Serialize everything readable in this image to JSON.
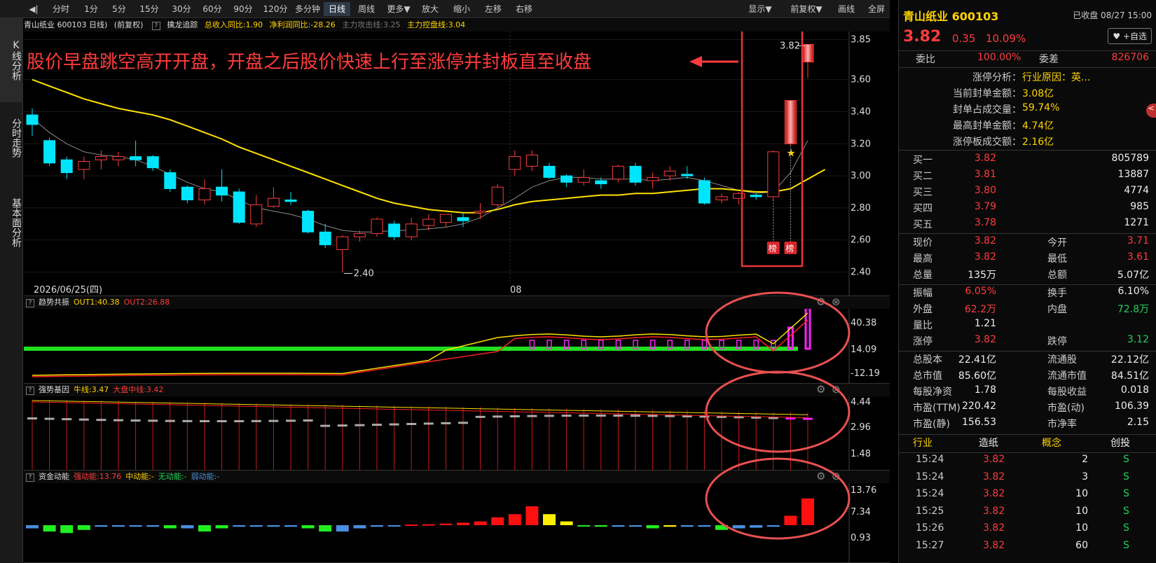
{
  "toolbar": {
    "items": [
      {
        "label": "◀|",
        "active": false
      },
      {
        "label": "分时",
        "active": false
      },
      {
        "label": "1分",
        "active": false
      },
      {
        "label": "5分",
        "active": false
      },
      {
        "label": "15分",
        "active": false
      },
      {
        "label": "30分",
        "active": false
      },
      {
        "label": "60分",
        "active": false
      },
      {
        "label": "90分",
        "active": false
      },
      {
        "label": "120分",
        "active": false
      },
      {
        "label": "多分钟",
        "active": false
      },
      {
        "label": "日线",
        "active": true
      },
      {
        "label": "周线",
        "active": false
      },
      {
        "label": "更多▼",
        "active": false
      },
      {
        "label": "放大",
        "active": false
      },
      {
        "label": "缩小",
        "active": false
      },
      {
        "label": "左移",
        "active": false
      },
      {
        "label": "右移",
        "active": false
      }
    ],
    "right_items": [
      "显示▼",
      "前复权▼",
      "画线",
      "全屏"
    ]
  },
  "left_nav": [
    "K线分析",
    "分时走势",
    "基本面分析"
  ],
  "main_panel": {
    "header": {
      "name": "青山纸业 600103 日线)",
      "fq": "(前复权)",
      "indicator": "擒龙追踪",
      "f1": "总收入同比:1.90",
      "f2": "净利润同比:-28.26",
      "f3": "主力攻击线:3.25",
      "f4": "主力控盘线:3.04"
    },
    "annotation": "股价早盘跳空高开开盘，开盘之后股价快速上行至涨停并封板直至收盘",
    "date_label": "2026/06/25(四)",
    "month_label": "08",
    "low_label": "2.40",
    "high_label": "3.82",
    "badge": "榜",
    "y_ticks": [
      "3.85",
      "3.60",
      "3.40",
      "3.20",
      "3.00",
      "2.80",
      "2.60",
      "2.40"
    ]
  },
  "panels": [
    {
      "id": "trend",
      "name": "趋势共振",
      "vals": [
        {
          "text": "OUT1:40.38",
          "color": "#ffd400"
        },
        {
          "text": "OUT2:26.88",
          "color": "#ff3c3c"
        }
      ],
      "ticks": [
        "40.38",
        "14.09",
        "-12.19"
      ]
    },
    {
      "id": "strong",
      "name": "强势基因",
      "vals": [
        {
          "text": "牛线:3.47",
          "color": "#ffd400"
        },
        {
          "text": "大盘中线:3.42",
          "color": "#ff3c3c"
        }
      ],
      "ticks": [
        "4.44",
        "2.96",
        "1.48"
      ]
    },
    {
      "id": "money",
      "name": "资金动能",
      "vals": [
        {
          "text": "强动能:13.76",
          "color": "#ff3c3c"
        },
        {
          "text": "中动能:-",
          "color": "#ffd400"
        },
        {
          "text": "无动能:-",
          "color": "#1fd35a"
        },
        {
          "text": "弱动能:-",
          "color": "#4a8fe0"
        }
      ],
      "ticks": [
        "13.76",
        "7.34",
        "0.93"
      ]
    }
  ],
  "chart_data": {
    "type": "candlestick",
    "y_range": [
      2.35,
      3.9
    ],
    "candles": [
      [
        3.38,
        3.32,
        3.42,
        3.25
      ],
      [
        3.22,
        3.08,
        3.24,
        3.06
      ],
      [
        3.1,
        3.02,
        3.12,
        2.98
      ],
      [
        3.04,
        3.09,
        3.12,
        2.98
      ],
      [
        3.1,
        3.12,
        3.16,
        3.04
      ],
      [
        3.1,
        3.12,
        3.15,
        3.06
      ],
      [
        3.12,
        3.1,
        3.22,
        3.06
      ],
      [
        3.12,
        3.05,
        3.13,
        3.03
      ],
      [
        3.02,
        2.92,
        3.04,
        2.9
      ],
      [
        2.93,
        2.85,
        2.94,
        2.83
      ],
      [
        2.85,
        2.92,
        2.98,
        2.82
      ],
      [
        2.93,
        2.88,
        3.04,
        2.84
      ],
      [
        2.9,
        2.71,
        2.92,
        2.7
      ],
      [
        2.7,
        2.82,
        2.88,
        2.68
      ],
      [
        2.81,
        2.86,
        2.93,
        2.8
      ],
      [
        2.85,
        2.84,
        2.9,
        2.82
      ],
      [
        2.78,
        2.65,
        2.79,
        2.64
      ],
      [
        2.65,
        2.57,
        2.7,
        2.55
      ],
      [
        2.54,
        2.62,
        2.63,
        2.4
      ],
      [
        2.62,
        2.64,
        2.66,
        2.59
      ],
      [
        2.64,
        2.73,
        2.74,
        2.62
      ],
      [
        2.7,
        2.62,
        2.72,
        2.6
      ],
      [
        2.62,
        2.7,
        2.74,
        2.6
      ],
      [
        2.69,
        2.73,
        2.76,
        2.66
      ],
      [
        2.71,
        2.76,
        2.76,
        2.68
      ],
      [
        2.74,
        2.72,
        2.77,
        2.68
      ],
      [
        2.77,
        2.78,
        2.83,
        2.73
      ],
      [
        2.82,
        2.93,
        2.95,
        2.79
      ],
      [
        3.04,
        3.12,
        3.16,
        3.0
      ],
      [
        3.06,
        3.13,
        3.16,
        3.03
      ],
      [
        3.06,
        2.99,
        3.08,
        2.98
      ],
      [
        3.0,
        2.96,
        3.01,
        2.93
      ],
      [
        2.96,
        2.99,
        3.04,
        2.94
      ],
      [
        2.97,
        2.95,
        2.99,
        2.92
      ],
      [
        2.98,
        3.06,
        3.07,
        2.96
      ],
      [
        3.06,
        2.96,
        3.08,
        2.94
      ],
      [
        2.97,
        2.99,
        3.02,
        2.92
      ],
      [
        3.0,
        3.03,
        3.06,
        2.97
      ],
      [
        3.01,
        3.0,
        3.06,
        2.98
      ],
      [
        2.97,
        2.83,
        2.99,
        2.82
      ],
      [
        2.85,
        2.87,
        2.89,
        2.83
      ],
      [
        2.86,
        2.89,
        2.9,
        2.82
      ],
      [
        2.88,
        2.87,
        2.89,
        2.85
      ],
      [
        2.87,
        3.15,
        3.16,
        2.85
      ],
      [
        3.47,
        3.2,
        3.47,
        3.19
      ],
      [
        3.82,
        3.71,
        3.82,
        3.61
      ]
    ],
    "ma_yellow": [
      3.6,
      3.56,
      3.52,
      3.48,
      3.45,
      3.42,
      3.4,
      3.38,
      3.35,
      3.31,
      3.27,
      3.23,
      3.18,
      3.14,
      3.1,
      3.06,
      3.02,
      2.98,
      2.94,
      2.9,
      2.86,
      2.83,
      2.81,
      2.79,
      2.78,
      2.77,
      2.77,
      2.79,
      2.82,
      2.84,
      2.85,
      2.86,
      2.87,
      2.88,
      2.88,
      2.89,
      2.89,
      2.9,
      2.91,
      2.92,
      2.92,
      2.91,
      2.9,
      2.9,
      2.92,
      2.98,
      3.04
    ],
    "ma_gray": [
      3.36,
      3.27,
      3.2,
      3.15,
      3.13,
      3.12,
      3.1,
      3.06,
      3.01,
      2.96,
      2.92,
      2.9,
      2.85,
      2.8,
      2.78,
      2.76,
      2.73,
      2.69,
      2.66,
      2.65,
      2.65,
      2.66,
      2.66,
      2.67,
      2.68,
      2.7,
      2.74,
      2.8,
      2.86,
      2.93,
      2.97,
      2.99,
      2.99,
      2.98,
      2.98,
      2.98,
      2.97,
      2.98,
      2.99,
      2.97,
      2.94,
      2.91,
      2.89,
      2.9,
      3.02,
      3.22
    ]
  }
}
